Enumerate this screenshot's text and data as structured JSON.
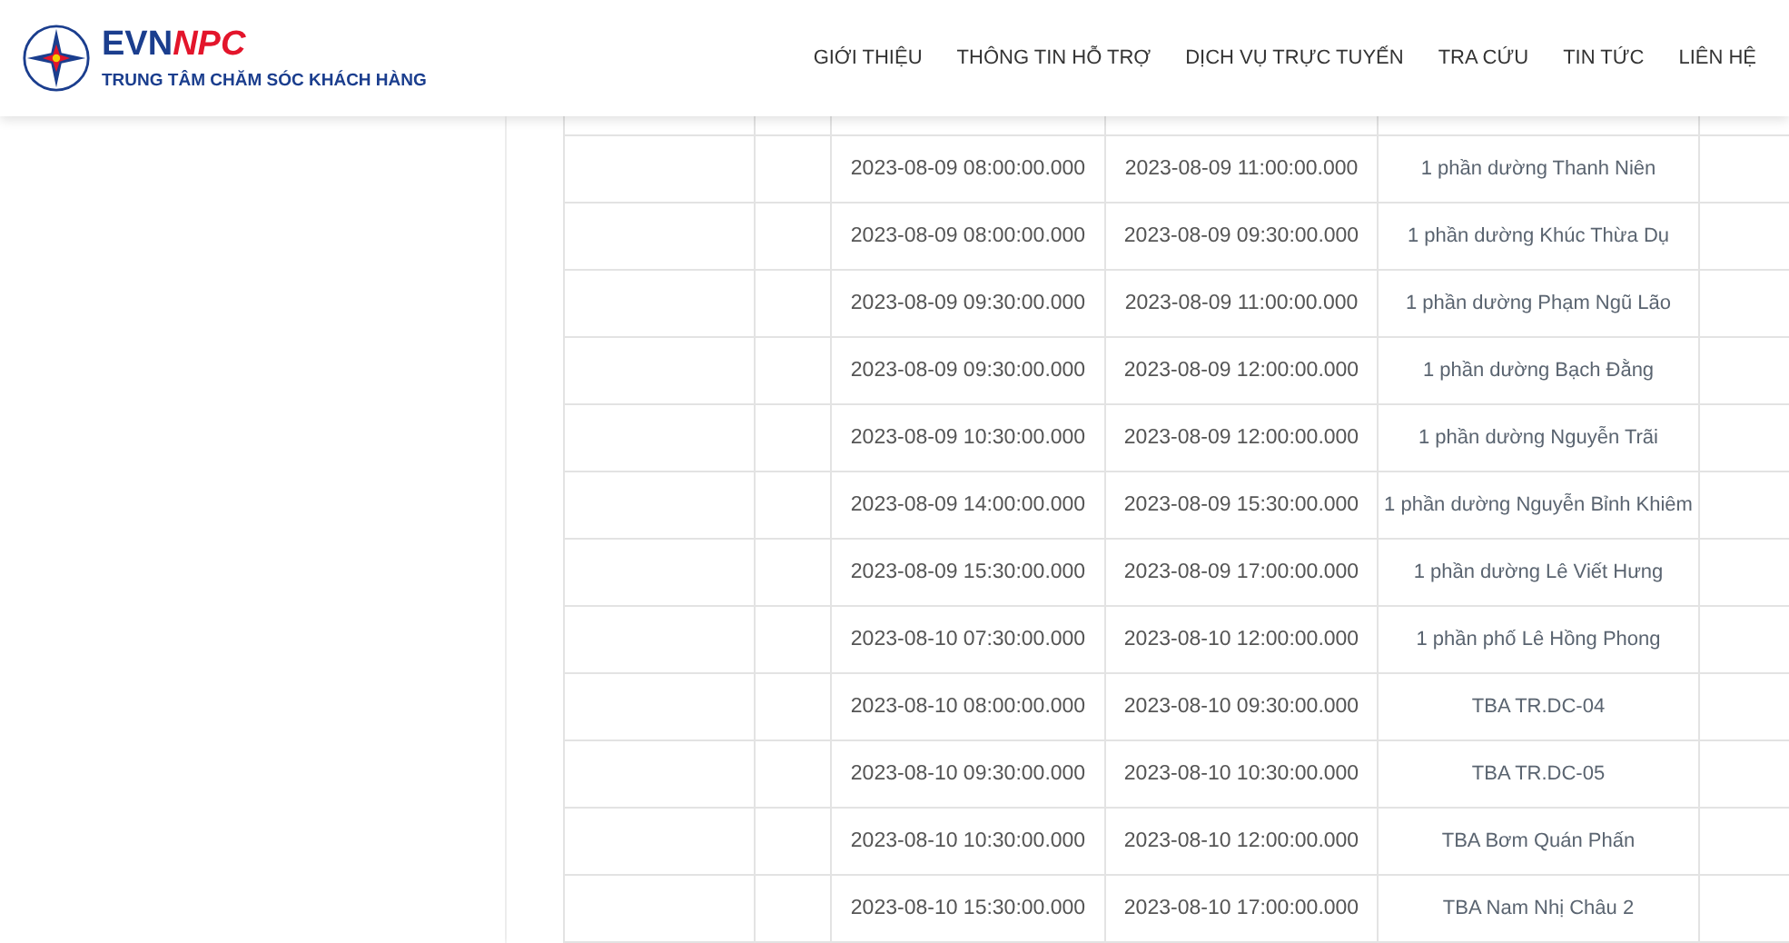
{
  "header": {
    "logo": {
      "brand": "EVN",
      "brand_accent": "NPC",
      "subtitle": "TRUNG TÂM CHĂM SÓC KHÁCH HÀNG"
    },
    "nav": [
      "GIỚI THIỆU",
      "THÔNG TIN HỖ TRỢ",
      "DỊCH VỤ TRỰC TUYẾN",
      "TRA CỨU",
      "TIN TỨC",
      "LIÊN HỆ"
    ]
  },
  "table": {
    "rows": [
      {
        "start": "2023-08-09 08:00:00.000",
        "end": "2023-08-09 11:00:00.000",
        "area": "1 phần dường Thanh Niên"
      },
      {
        "start": "2023-08-09 08:00:00.000",
        "end": "2023-08-09 09:30:00.000",
        "area": "1 phần dường Khúc Thừa Dụ"
      },
      {
        "start": "2023-08-09 09:30:00.000",
        "end": "2023-08-09 11:00:00.000",
        "area": "1 phần dường Phạm Ngũ Lão"
      },
      {
        "start": "2023-08-09 09:30:00.000",
        "end": "2023-08-09 12:00:00.000",
        "area": "1 phần dường Bạch Đằng"
      },
      {
        "start": "2023-08-09 10:30:00.000",
        "end": "2023-08-09 12:00:00.000",
        "area": "1 phần dường Nguyễn Trãi"
      },
      {
        "start": "2023-08-09 14:00:00.000",
        "end": "2023-08-09 15:30:00.000",
        "area": "1 phần dường Nguyễn Bỉnh Khiêm"
      },
      {
        "start": "2023-08-09 15:30:00.000",
        "end": "2023-08-09 17:00:00.000",
        "area": "1 phần dường Lê Viết Hưng"
      },
      {
        "start": "2023-08-10 07:30:00.000",
        "end": "2023-08-10 12:00:00.000",
        "area": "1 phần phố Lê Hồng Phong"
      },
      {
        "start": "2023-08-10 08:00:00.000",
        "end": "2023-08-10 09:30:00.000",
        "area": "TBA TR.DC-04"
      },
      {
        "start": "2023-08-10 09:30:00.000",
        "end": "2023-08-10 10:30:00.000",
        "area": "TBA TR.DC-05"
      },
      {
        "start": "2023-08-10 10:30:00.000",
        "end": "2023-08-10 12:00:00.000",
        "area": "TBA Bơm Quán Phấn"
      },
      {
        "start": "2023-08-10 15:30:00.000",
        "end": "2023-08-10 17:00:00.000",
        "area": "TBA Nam Nhị Châu 2"
      }
    ]
  }
}
